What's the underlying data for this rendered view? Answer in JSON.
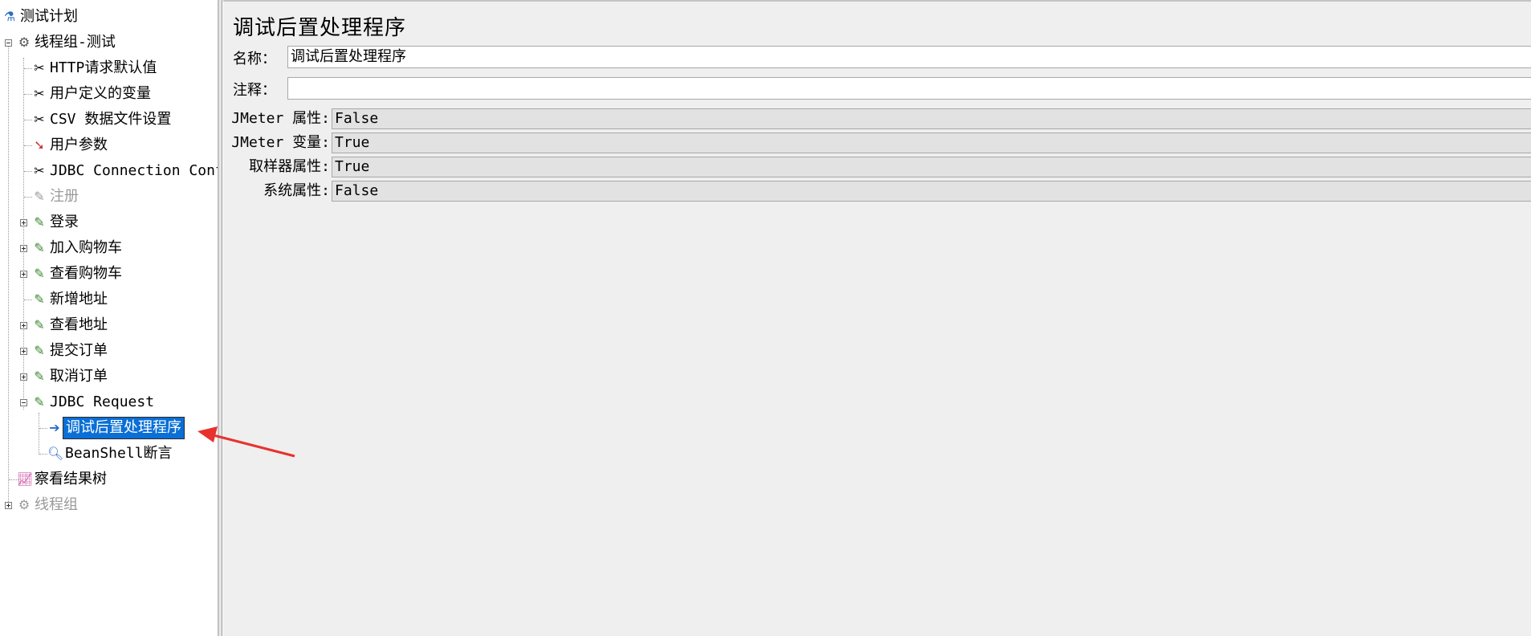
{
  "tree": {
    "items": [
      {
        "label": "测试计划",
        "icon": "test-plan-icon"
      },
      {
        "label": "线程组-测试",
        "icon": "thread-group-icon"
      },
      {
        "label": "HTTP请求默认值",
        "icon": "config-element-icon"
      },
      {
        "label": "用户定义的变量",
        "icon": "config-element-icon"
      },
      {
        "label": "CSV 数据文件设置",
        "icon": "config-element-icon"
      },
      {
        "label": "用户参数",
        "icon": "pre-processor-icon"
      },
      {
        "label": "JDBC Connection Confi",
        "icon": "config-element-icon"
      },
      {
        "label": "注册",
        "icon": "sampler-icon"
      },
      {
        "label": "登录",
        "icon": "sampler-icon"
      },
      {
        "label": "加入购物车",
        "icon": "sampler-icon"
      },
      {
        "label": "查看购物车",
        "icon": "sampler-icon"
      },
      {
        "label": "新增地址",
        "icon": "sampler-icon"
      },
      {
        "label": "查看地址",
        "icon": "sampler-icon"
      },
      {
        "label": "提交订单",
        "icon": "sampler-icon"
      },
      {
        "label": "取消订单",
        "icon": "sampler-icon"
      },
      {
        "label": "JDBC Request",
        "icon": "sampler-icon"
      },
      {
        "label": "调试后置处理程序",
        "icon": "post-processor-icon"
      },
      {
        "label": "BeanShell断言",
        "icon": "assertion-icon"
      },
      {
        "label": "察看结果树",
        "icon": "listener-icon"
      },
      {
        "label": "线程组",
        "icon": "thread-group-icon"
      }
    ]
  },
  "panel": {
    "title": "调试后置处理程序",
    "name_label": "名称：",
    "name_value": "调试后置处理程序",
    "comment_label": "注释：",
    "comment_value": "",
    "properties": [
      {
        "label": "JMeter 属性:",
        "value": "False"
      },
      {
        "label": "JMeter 变量:",
        "value": "True"
      },
      {
        "label": "取样器属性:",
        "value": "True"
      },
      {
        "label": "系统属性:",
        "value": "False"
      }
    ]
  },
  "colors": {
    "selection": "#0a6fd6",
    "annotation_arrow": "#e8322d"
  }
}
